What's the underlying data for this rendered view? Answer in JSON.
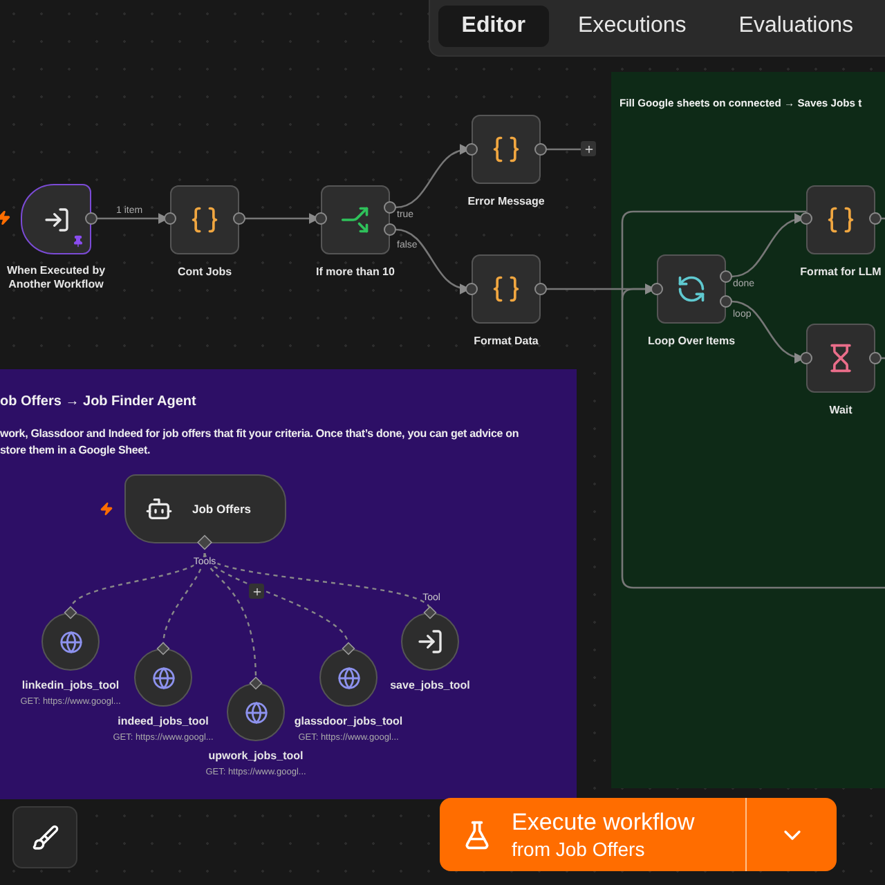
{
  "tabs": [
    {
      "label": "Editor",
      "selected": true
    },
    {
      "label": "Executions",
      "selected": false
    },
    {
      "label": "Evaluations",
      "selected": false
    }
  ],
  "notes": [
    {
      "color": "#2d0f66",
      "title": "ob Offers → Job Finder Agent",
      "text": "work, Glassdoor and Indeed for job offers that fit your criteria. Once that’s done, you can get advice on\nstore them in a Google Sheet."
    },
    {
      "color": "#0e2a17",
      "title": "Fill Google sheets on connected → Saves Jobs t"
    }
  ],
  "nodes": [
    {
      "kind": "trigger",
      "label": "When Executed by Another Workflow",
      "pinned": true,
      "output_label": "1 item"
    },
    {
      "kind": "action",
      "label": "Cont Jobs"
    },
    {
      "kind": "action",
      "label": "If more than 10",
      "outputs": [
        "true",
        "false"
      ]
    },
    {
      "kind": "action",
      "label": "Error Message"
    },
    {
      "kind": "action",
      "label": "Format Data"
    },
    {
      "kind": "action",
      "label": "Loop Over Items",
      "outputs": [
        "done",
        "loop"
      ]
    },
    {
      "kind": "action",
      "label": "Format for LLM"
    },
    {
      "kind": "action",
      "label": "Wait"
    },
    {
      "kind": "agent",
      "label": "Job Offers",
      "port_label": "Tools"
    },
    {
      "kind": "tool",
      "label": "linkedin_jobs_tool",
      "subtitle": "GET: https://www.googl..."
    },
    {
      "kind": "tool",
      "label": "indeed_jobs_tool",
      "subtitle": "GET: https://www.googl..."
    },
    {
      "kind": "tool",
      "label": "upwork_jobs_tool",
      "subtitle": "GET: https://www.googl..."
    },
    {
      "kind": "tool",
      "label": "glassdoor_jobs_tool",
      "subtitle": "GET: https://www.googl..."
    },
    {
      "kind": "tool",
      "label": "save_jobs_tool",
      "port_label": "Tool"
    }
  ],
  "execute_button": {
    "title": "Execute workflow",
    "subtitle": "from Job Offers"
  }
}
